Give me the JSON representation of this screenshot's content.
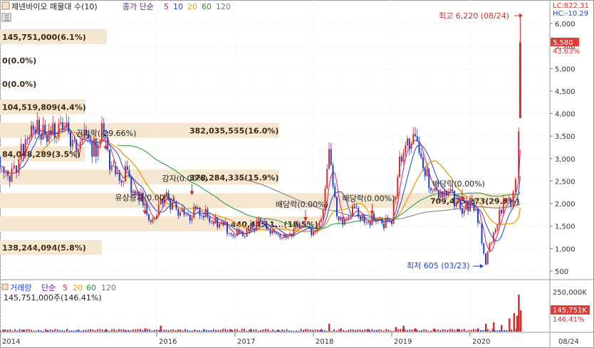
{
  "header": {
    "title": "제넨바이오 매물대 수(10)",
    "ma_label": "종가 단순",
    "ma_periods": [
      "5",
      "10",
      "20",
      "60",
      "120"
    ],
    "ma_colors": [
      "#d81b60",
      "#1e3fd6",
      "#e8a317",
      "#1a9a3a",
      "#777777"
    ],
    "lc": "LC:822.31",
    "hc": "HC:-10.29"
  },
  "volume_header": {
    "title": "거래량",
    "ma_label": "단순",
    "ma_periods": [
      "5",
      "20",
      "60",
      "120"
    ],
    "ma_colors": [
      "#d81b60",
      "#e8a317",
      "#1a9a3a",
      "#777777"
    ],
    "readout": "145,751,000주(146.41%)"
  },
  "chart_data": {
    "type": "candlestick",
    "title": "제넨바이오 매물대 수(10)",
    "y_axis": {
      "ticks": [
        "500",
        "1,000",
        "1,500",
        "2,000",
        "2,500",
        "3,000",
        "3,500",
        "4,000",
        "4,500",
        "5,000",
        "5,500",
        "6,000"
      ],
      "range": [
        400,
        6300
      ]
    },
    "x_axis": {
      "ticks": [
        "2014",
        "2016",
        "2017",
        "2018",
        "2019",
        "2020",
        "08/24"
      ]
    },
    "current_price": {
      "value": "5,580",
      "change": "43.63%"
    },
    "annotations": {
      "high": "최고 6,220 (08/24)",
      "low": "최저 605 (03/23)",
      "events": [
        {
          "label": "권리락(-29.66%)",
          "x_year": 2015.35,
          "price": 3500
        },
        {
          "label": "감자(0.00%)",
          "x_year": 2016.45,
          "price": 2500
        },
        {
          "label": "유상증자(0.00%)",
          "x_year": 2015.85,
          "price": 2070
        },
        {
          "label": "배당락(0.00%)",
          "x_year": 2017.9,
          "price": 1920
        },
        {
          "label": "배당락(0.00%)",
          "x_year": 2018.75,
          "price": 2060
        },
        {
          "label": "배당락(0.00%)",
          "x_year": 2019.9,
          "price": 2380
        }
      ]
    },
    "volume_profile": [
      {
        "label": "145,751,000(6.1%)",
        "price": 5700,
        "width": 150
      },
      {
        "label": "0(0.0%)",
        "price": 5180,
        "width": 0
      },
      {
        "label": "0(0.0%)",
        "price": 4660,
        "width": 0
      },
      {
        "label": "104,519,809(4.4%)",
        "price": 4140,
        "width": 120
      },
      {
        "label": "382,035,555(16.0%)",
        "price": 3620,
        "width": 392
      },
      {
        "label": "84,048,289(3.5%)",
        "price": 3100,
        "width": 120
      },
      {
        "label": "378,284,335(15.9%)",
        "price": 2580,
        "width": 392
      },
      {
        "label": "709,475,273(29.8%)",
        "price": 2060,
        "width": 730
      },
      {
        "label": "440,445,1...(18.5%)",
        "price": 1540,
        "width": 450
      },
      {
        "label": "138,244,094(5.8%)",
        "price": 1020,
        "width": 143
      }
    ],
    "volume_axis": {
      "ticks": [
        "250,000K"
      ],
      "current": "145,751K",
      "current_pct": "146.41%"
    },
    "price_path": [
      [
        2014.0,
        3050
      ],
      [
        2014.15,
        2600
      ],
      [
        2014.3,
        3300
      ],
      [
        2014.4,
        3700
      ],
      [
        2014.5,
        3600
      ],
      [
        2014.6,
        3400
      ],
      [
        2014.75,
        3700
      ],
      [
        2014.9,
        3450
      ],
      [
        2015.0,
        3300
      ],
      [
        2015.1,
        3500
      ],
      [
        2015.2,
        3200
      ],
      [
        2015.3,
        3600
      ],
      [
        2015.4,
        2900
      ],
      [
        2015.5,
        2500
      ],
      [
        2015.6,
        2700
      ],
      [
        2015.7,
        2300
      ],
      [
        2015.8,
        2100
      ],
      [
        2015.9,
        1650
      ],
      [
        2016.0,
        1700
      ],
      [
        2016.1,
        2250
      ],
      [
        2016.2,
        1950
      ],
      [
        2016.3,
        1800
      ],
      [
        2016.4,
        1700
      ],
      [
        2016.5,
        1900
      ],
      [
        2016.6,
        1800
      ],
      [
        2016.7,
        1650
      ],
      [
        2016.8,
        1550
      ],
      [
        2016.9,
        1450
      ],
      [
        2017.0,
        1350
      ],
      [
        2017.1,
        1300
      ],
      [
        2017.2,
        1450
      ],
      [
        2017.3,
        1600
      ],
      [
        2017.4,
        1500
      ],
      [
        2017.5,
        1380
      ],
      [
        2017.6,
        1300
      ],
      [
        2017.7,
        1320
      ],
      [
        2017.8,
        1450
      ],
      [
        2017.9,
        1380
      ],
      [
        2018.0,
        1380
      ],
      [
        2018.1,
        1600
      ],
      [
        2018.15,
        2300
      ],
      [
        2018.2,
        3000
      ],
      [
        2018.25,
        2400
      ],
      [
        2018.3,
        1800
      ],
      [
        2018.4,
        1600
      ],
      [
        2018.5,
        1850
      ],
      [
        2018.6,
        1700
      ],
      [
        2018.7,
        1600
      ],
      [
        2018.8,
        1700
      ],
      [
        2018.9,
        1550
      ],
      [
        2019.0,
        1600
      ],
      [
        2019.05,
        2300
      ],
      [
        2019.1,
        2900
      ],
      [
        2019.15,
        3100
      ],
      [
        2019.2,
        3500
      ],
      [
        2019.3,
        3300
      ],
      [
        2019.4,
        2800
      ],
      [
        2019.5,
        2400
      ],
      [
        2019.6,
        2200
      ],
      [
        2019.7,
        2300
      ],
      [
        2019.8,
        2050
      ],
      [
        2019.9,
        1900
      ],
      [
        2020.0,
        2000
      ],
      [
        2020.1,
        1700
      ],
      [
        2020.15,
        1200
      ],
      [
        2020.2,
        700
      ],
      [
        2020.25,
        1100
      ],
      [
        2020.35,
        1600
      ],
      [
        2020.45,
        2100
      ],
      [
        2020.52,
        2000
      ],
      [
        2020.58,
        2600
      ],
      [
        2020.62,
        3600
      ],
      [
        2020.64,
        5580
      ]
    ],
    "volume_bars": [
      [
        2014.05,
        2
      ],
      [
        2014.3,
        3
      ],
      [
        2014.6,
        2
      ],
      [
        2015.0,
        3
      ],
      [
        2015.35,
        4
      ],
      [
        2015.6,
        2
      ],
      [
        2015.85,
        5
      ],
      [
        2016.05,
        9
      ],
      [
        2016.3,
        3
      ],
      [
        2016.6,
        4
      ],
      [
        2016.95,
        3
      ],
      [
        2017.2,
        4
      ],
      [
        2017.55,
        3
      ],
      [
        2017.9,
        4
      ],
      [
        2018.1,
        4
      ],
      [
        2018.2,
        12
      ],
      [
        2018.35,
        5
      ],
      [
        2018.7,
        4
      ],
      [
        2019.05,
        7
      ],
      [
        2019.15,
        9
      ],
      [
        2019.3,
        5
      ],
      [
        2019.55,
        4
      ],
      [
        2019.85,
        4
      ],
      [
        2020.1,
        5
      ],
      [
        2020.2,
        12
      ],
      [
        2020.3,
        14
      ],
      [
        2020.4,
        10
      ],
      [
        2020.5,
        20
      ],
      [
        2020.56,
        28
      ],
      [
        2020.6,
        24
      ],
      [
        2020.62,
        56
      ],
      [
        2020.645,
        32
      ]
    ]
  }
}
